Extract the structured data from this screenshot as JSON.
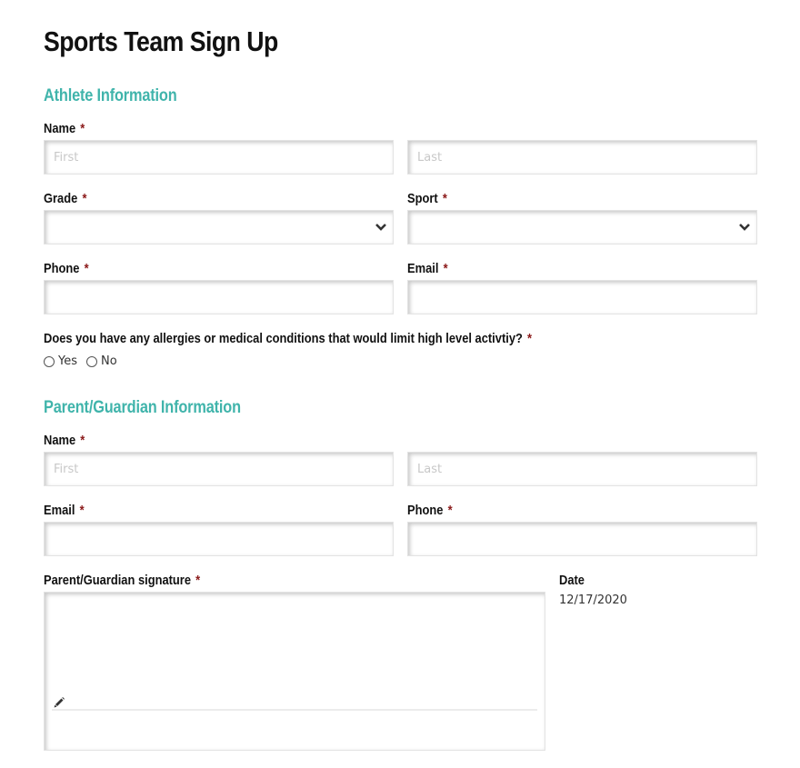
{
  "title": "Sports Team Sign Up",
  "required_marker": "*",
  "athlete": {
    "heading": "Athlete Information",
    "name_label": "Name",
    "first_placeholder": "First",
    "last_placeholder": "Last",
    "first_value": "",
    "last_value": "",
    "grade_label": "Grade",
    "grade_selected": "",
    "sport_label": "Sport",
    "sport_selected": "",
    "phone_label": "Phone",
    "phone_value": "",
    "email_label": "Email",
    "email_value": "",
    "medical_question": "Does you have any allergies or medical conditions that would limit high level activtiy?",
    "medical_options": [
      "Yes",
      "No"
    ]
  },
  "parent": {
    "heading": "Parent/Guardian Information",
    "name_label": "Name",
    "first_placeholder": "First",
    "last_placeholder": "Last",
    "first_value": "",
    "last_value": "",
    "email_label": "Email",
    "email_value": "",
    "phone_label": "Phone",
    "phone_value": "",
    "signature_label": "Parent/Guardian signature",
    "date_label": "Date",
    "date_value": "12/17/2020"
  },
  "icons": {
    "select_chevron": "chevron-down-icon",
    "signature_pen": "pencil-icon"
  },
  "colors": {
    "section_heading": "#40b4ab",
    "required": "#8b1a1a"
  }
}
